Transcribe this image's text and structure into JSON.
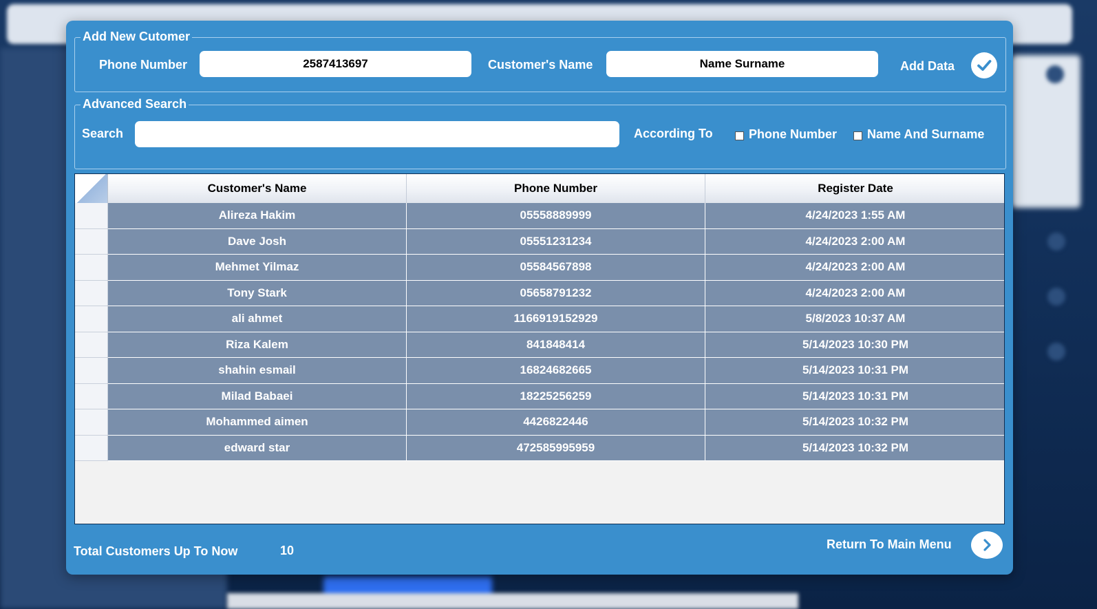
{
  "add_group": {
    "title": "Add New Cutomer",
    "phone_label": "Phone Number",
    "phone_value": "2587413697",
    "name_label": "Customer's Name",
    "name_value": "Name Surname",
    "add_label": "Add Data",
    "add_icon": "checkmark-icon"
  },
  "search_group": {
    "title": "Advanced Search",
    "search_label": "Search",
    "search_value": "",
    "according_label": "According To",
    "options": [
      {
        "label": "Phone Number",
        "checked": false
      },
      {
        "label": "Name And Surname",
        "checked": false
      }
    ]
  },
  "grid": {
    "columns": [
      "Customer's Name",
      "Phone Number",
      "Register Date"
    ],
    "rows": [
      {
        "name": "Alireza Hakim",
        "phone": "05558889999",
        "date": "4/24/2023 1:55 AM"
      },
      {
        "name": "Dave Josh",
        "phone": "05551231234",
        "date": "4/24/2023 2:00 AM"
      },
      {
        "name": "Mehmet Yilmaz",
        "phone": "05584567898",
        "date": "4/24/2023 2:00 AM"
      },
      {
        "name": "Tony Stark",
        "phone": "05658791232",
        "date": "4/24/2023 2:00 AM"
      },
      {
        "name": "ali ahmet",
        "phone": "1166919152929",
        "date": "5/8/2023 10:37 AM"
      },
      {
        "name": "Riza Kalem",
        "phone": "841848414",
        "date": "5/14/2023 10:30 PM"
      },
      {
        "name": "shahin esmail",
        "phone": "16824682665",
        "date": "5/14/2023 10:31 PM"
      },
      {
        "name": "Milad Babaei",
        "phone": "18225256259",
        "date": "5/14/2023 10:31 PM"
      },
      {
        "name": "Mohammed aimen",
        "phone": "4426822446",
        "date": "5/14/2023 10:32 PM"
      },
      {
        "name": "edward star",
        "phone": "472585995959",
        "date": "5/14/2023 10:32 PM"
      }
    ]
  },
  "footer": {
    "total_label": "Total Customers Up To Now",
    "total_value": "10",
    "return_label": "Return To Main Menu",
    "return_icon": "chevron-right-icon"
  },
  "colors": {
    "dialog_bg": "#3a8fcd",
    "row_bg": "#7a8fab",
    "text": "#ffffff"
  }
}
